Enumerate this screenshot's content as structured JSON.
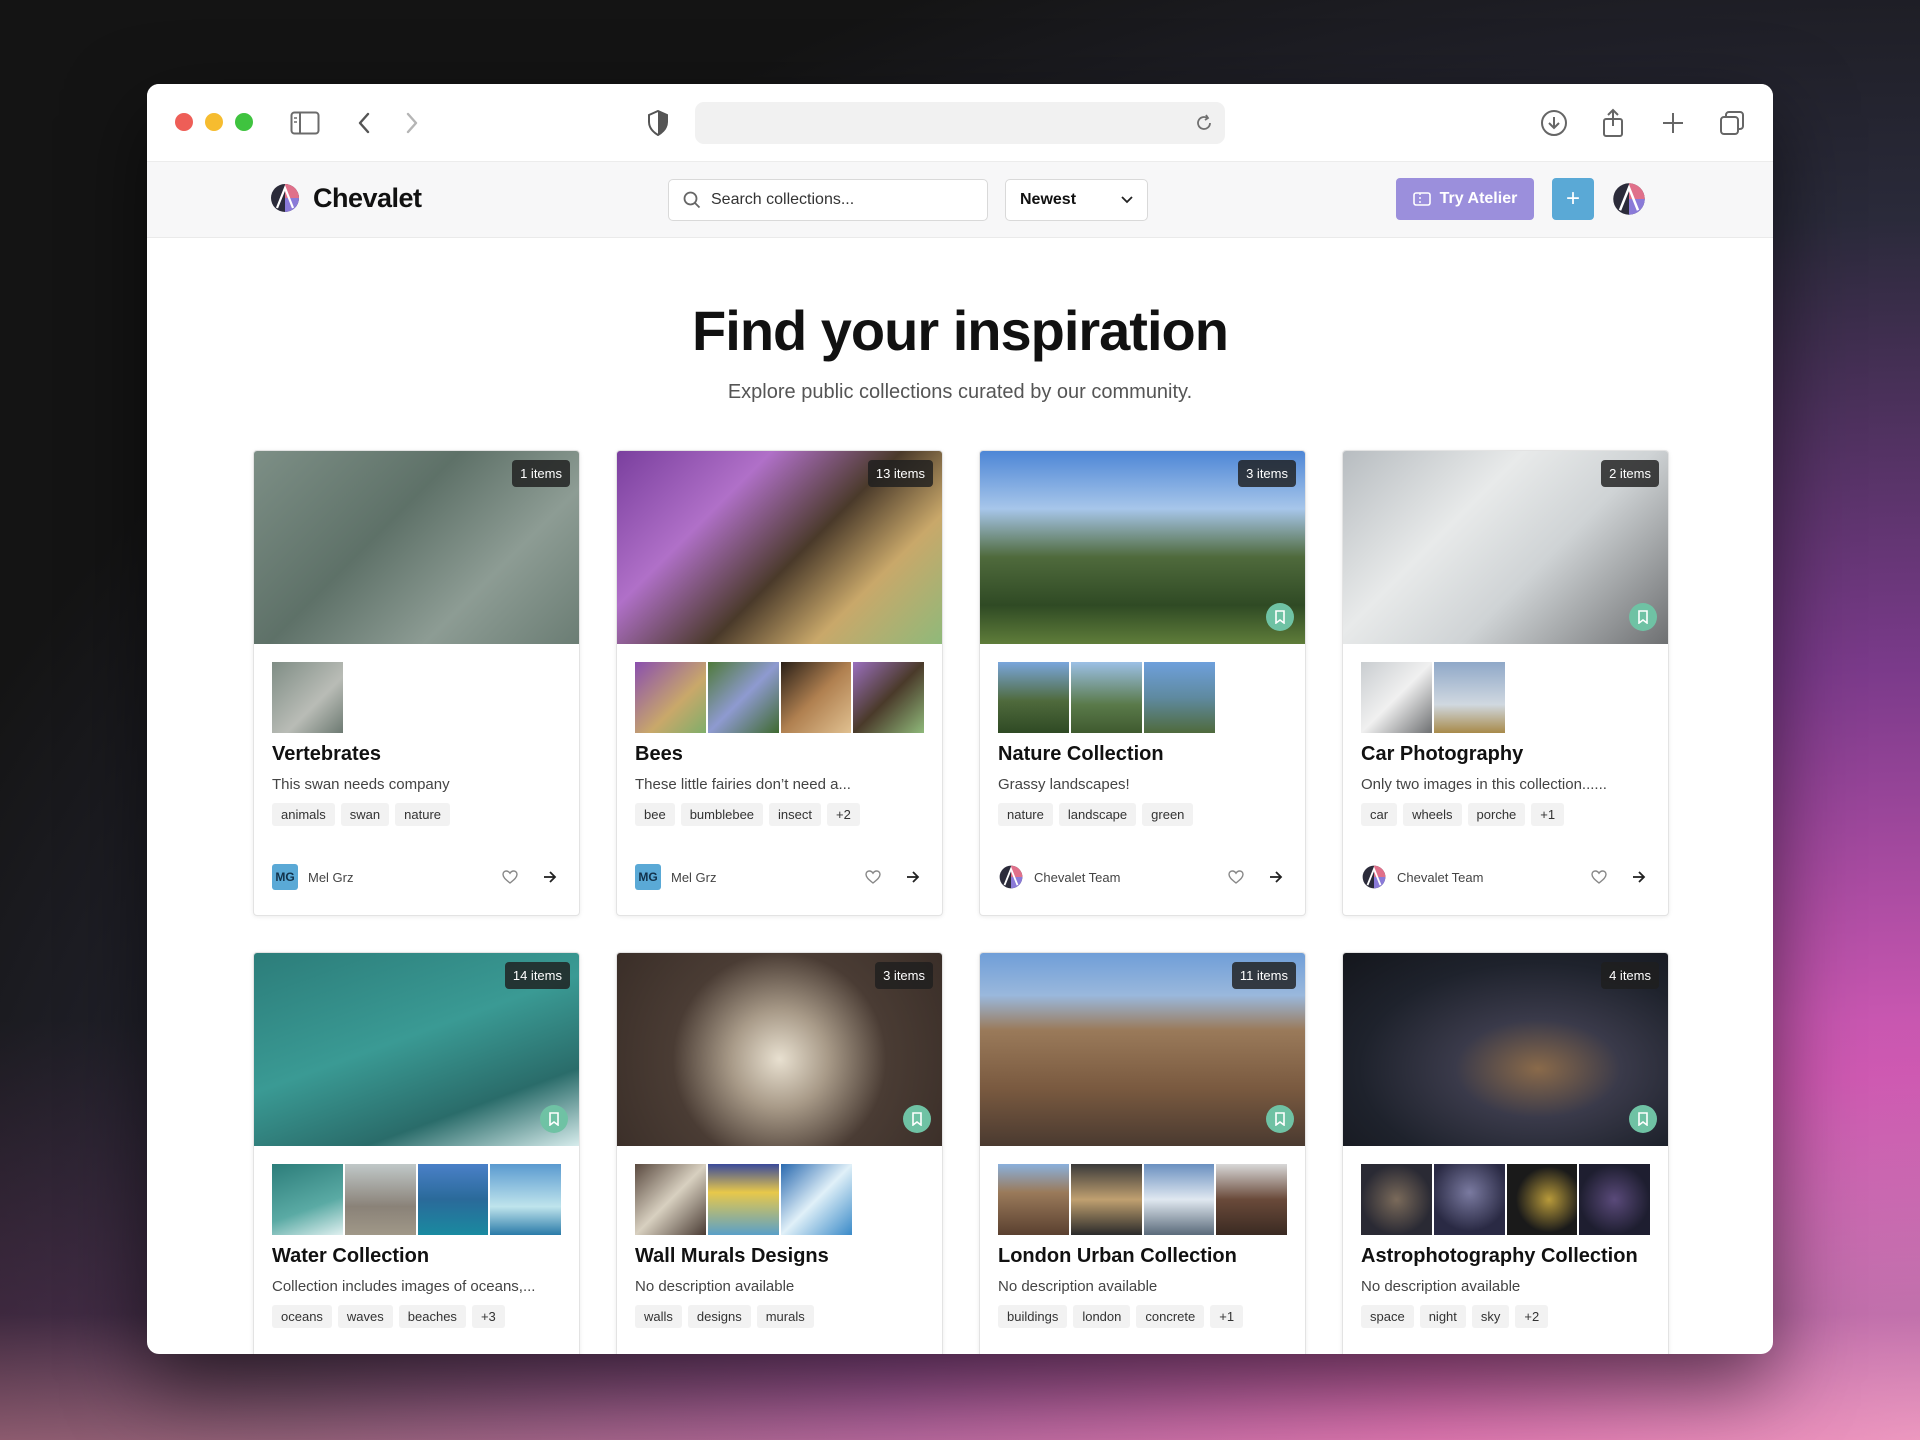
{
  "app": {
    "brand": "Chevalet"
  },
  "header": {
    "search_placeholder": "Search collections...",
    "sort_selected": "Newest",
    "try_label": "Try Atelier",
    "plus_label": "+"
  },
  "hero": {
    "title": "Find your inspiration",
    "subtitle": "Explore public collections curated by our community."
  },
  "collections": [
    {
      "count": "1 items",
      "title": "Vertebrates",
      "desc": "This swan needs company",
      "tags": [
        "animals",
        "swan",
        "nature"
      ],
      "author": "Mel Grz",
      "author_initials": "MG",
      "cover": "linear-gradient(135deg,#7d8f86 0%,#5e7168 40%,#8d9c94 70%,#6b7d74 100%)",
      "thumbs": [
        "linear-gradient(135deg,#7f8d85,#b9bcb6 60%,#6d7a72)"
      ],
      "bookmark": false
    },
    {
      "count": "13 items",
      "title": "Bees",
      "desc": "These little fairies don’t need a...",
      "tags": [
        "bee",
        "bumblebee",
        "insect",
        "+2"
      ],
      "author": "Mel Grz",
      "author_initials": "MG",
      "cover": "linear-gradient(135deg,#7a3f9e 0%,#b070c8 30%,#4a3a2a 55%,#c9a86a 75%,#8fb97a 100%)",
      "thumbs": [
        "linear-gradient(135deg,#8a4fae,#c9a86a 60%,#7fae6a)",
        "linear-gradient(135deg,#4f7a3a,#8e9ad0 50%,#3f6a30)",
        "linear-gradient(135deg,#2a2018,#b08050 50%,#e0c090)",
        "linear-gradient(135deg,#9a6fbe,#4a3a2a 50%,#8fb97a)"
      ],
      "bookmark": false
    },
    {
      "count": "3 items",
      "title": "Nature Collection",
      "desc": "Grassy landscapes!",
      "tags": [
        "nature",
        "landscape",
        "green"
      ],
      "author": "Chevalet Team",
      "author_initials": "",
      "cover": "linear-gradient(180deg,#4d86d6 0%,#a7c6ea 30%,#4f6a3c 55%,#2f4a24 80%,#5f7d3a 100%)",
      "thumbs": [
        "linear-gradient(180deg,#7aa6dc,#4f6a3c 55%,#2f4a24)",
        "linear-gradient(180deg,#9cc0e6,#5a7a4a 60%,#3f5a2f)",
        "linear-gradient(180deg,#6ea0dc,#5f8aa0 50%,#4f6a3c)"
      ],
      "bookmark": true
    },
    {
      "count": "2 items",
      "title": "Car Photography",
      "desc": "Only two images in this collection......",
      "tags": [
        "car",
        "wheels",
        "porche",
        "+1"
      ],
      "author": "Chevalet Team",
      "author_initials": "",
      "cover": "linear-gradient(135deg,#b7bcc0 0%,#e8eaea 35%,#cfd3d5 60%,#6e7072 100%)",
      "thumbs": [
        "linear-gradient(135deg,#c9cdd0,#f0f0f0 50%,#6e7072)",
        "linear-gradient(180deg,#8fa8c8,#d0d8e0 60%,#a88a4a)"
      ],
      "bookmark": true
    },
    {
      "count": "14 items",
      "title": "Water Collection",
      "desc": "Collection includes images of oceans,...",
      "tags": [
        "oceans",
        "waves",
        "beaches",
        "+3"
      ],
      "author": "",
      "author_initials": "",
      "cover": "linear-gradient(160deg,#2c7d7a 0%,#3a9a94 45%,#2a6c6a 75%,#d7ecec 100%)",
      "thumbs": [
        "linear-gradient(160deg,#2c7d7a,#5aaaa4 60%,#e0f0f0)",
        "linear-gradient(180deg,#c0c8c8,#8a8278 60%,#a09888)",
        "linear-gradient(180deg,#4a80c8,#2a6a9a 50%,#1a8aa0)",
        "linear-gradient(180deg,#5a9ad0,#bfe4ec 60%,#2a7aa8)"
      ],
      "bookmark": true
    },
    {
      "count": "3 items",
      "title": "Wall Murals Designs",
      "desc": "No description available",
      "tags": [
        "walls",
        "designs",
        "murals"
      ],
      "author": "",
      "author_initials": "",
      "cover": "radial-gradient(circle at 50% 55%,#e8e0d0 0%,#a89a88 25%,#4a3c34 55%,#3a2e28 100%)",
      "thumbs": [
        "linear-gradient(135deg,#5a4a40,#d8d0c0 50%,#4a3c34)",
        "linear-gradient(180deg,#3a4a9a,#e8c84a 40%,#5aa0c8)",
        "linear-gradient(135deg,#2a6ab0,#e0f0f8 50%,#3a8ac8)"
      ],
      "bookmark": true
    },
    {
      "count": "11 items",
      "title": "London Urban Collection",
      "desc": "No description available",
      "tags": [
        "buildings",
        "london",
        "concrete",
        "+1"
      ],
      "author": "",
      "author_initials": "",
      "cover": "linear-gradient(180deg,#6f9ed8 0%,#9ab8dc 22%,#9a7a5a 40%,#7a5a40 70%,#4a3a30 100%)",
      "thumbs": [
        "linear-gradient(180deg,#8ab0dc,#9a7a5a 40%,#5a4030)",
        "linear-gradient(180deg,#3a3a3a,#c0a070 50%,#2a2a2a)",
        "linear-gradient(180deg,#6a90c0,#e0e8f0 50%,#5a6a7a)",
        "linear-gradient(180deg,#d8d8d8,#6a4a3a 50%,#3a2a22)"
      ],
      "bookmark": true
    },
    {
      "count": "4 items",
      "title": "Astrophotography Collection",
      "desc": "No description available",
      "tags": [
        "space",
        "night",
        "sky",
        "+2"
      ],
      "author": "",
      "author_initials": "",
      "cover": "radial-gradient(ellipse at 60% 60%,#8a6a4a 0%,#3a3a4a 30%,#1e222c 65%,#14161c 100%)",
      "thumbs": [
        "radial-gradient(circle at 50% 50%,#7a6a5a,#2a2a34 70%)",
        "radial-gradient(circle at 50% 40%,#7a7aa0,#2a2a44 70%)",
        "radial-gradient(circle at 60% 50%,#b89a3a,#1a1a1a 60%)",
        "radial-gradient(circle at 50% 50%,#5a4a7a,#1e1e30 70%)"
      ],
      "bookmark": true
    }
  ]
}
